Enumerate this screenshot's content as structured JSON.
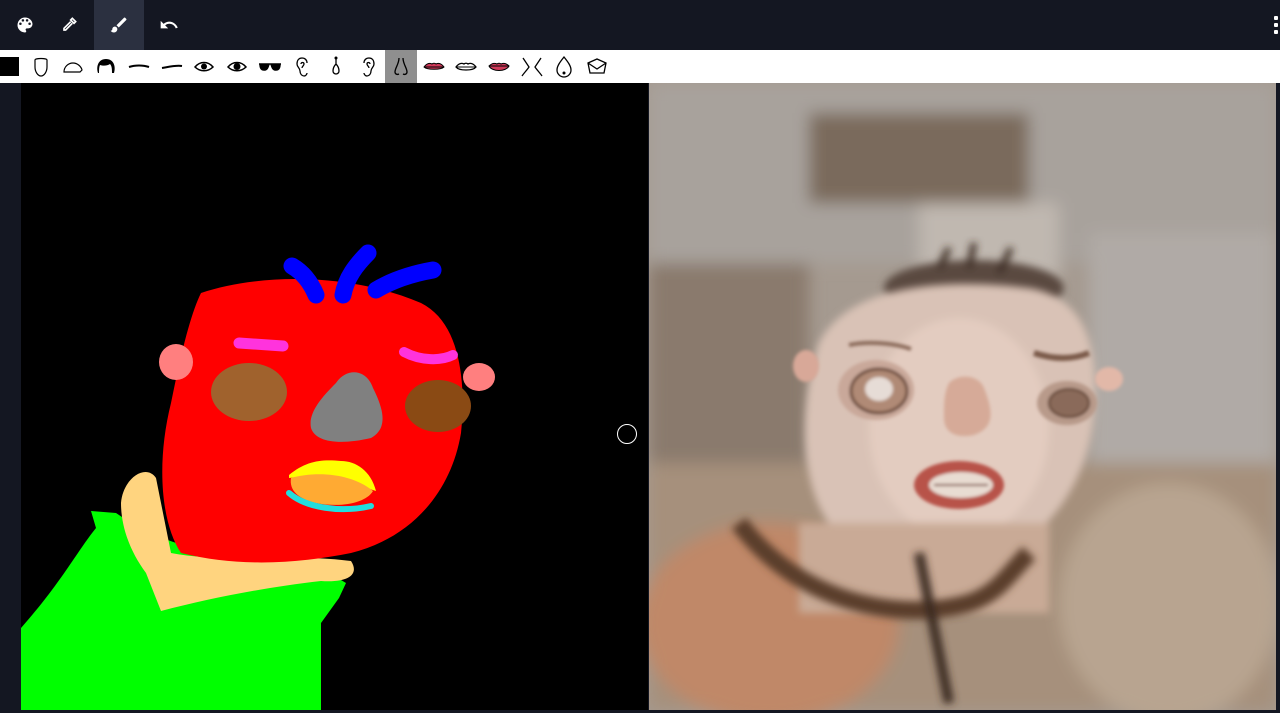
{
  "toolbar": {
    "tools": [
      {
        "name": "palette-icon",
        "active": false
      },
      {
        "name": "eyedropper-icon",
        "active": false
      },
      {
        "name": "brush-icon",
        "active": true
      },
      {
        "name": "undo-icon",
        "active": false
      }
    ],
    "menu_icon": "vertical-dots-icon"
  },
  "label_bar": {
    "items": [
      "background",
      "skin",
      "cloth",
      "hair",
      "left-brow",
      "right-brow",
      "left-eye",
      "right-eye",
      "eyeglasses",
      "left-ear",
      "earring",
      "right-ear",
      "nose",
      "upper-lip",
      "mouth",
      "lower-lip",
      "neck",
      "necklace",
      "hat"
    ],
    "selected": "nose"
  },
  "colors": {
    "toolbar_bg": "#141722",
    "active_tool_bg": "#2b3040",
    "selected_label_bg": "#8f8f8f",
    "skin": "#ff0000",
    "hair": "#0000ff",
    "brows": "#ff33dd",
    "ears": "#ff7f7f",
    "eyes": "#a0622d",
    "nose": "#808080",
    "cloth": "#00ff00",
    "neck": "#ffd47f"
  }
}
